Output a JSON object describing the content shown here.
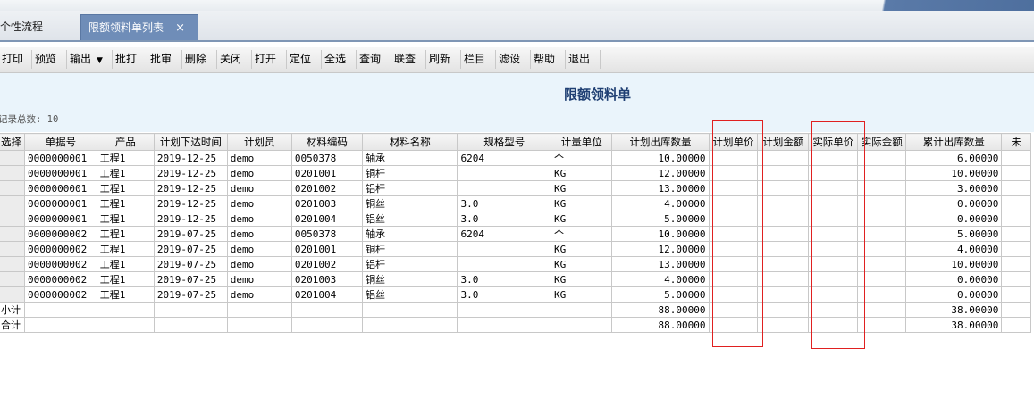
{
  "tabs": [
    {
      "label": "个性流程"
    },
    {
      "label": "限额领料单列表",
      "close": "×"
    }
  ],
  "toolbar": {
    "buttons": [
      "打印",
      "预览",
      "输出",
      "批打",
      "批审",
      "删除",
      "关闭",
      "打开",
      "定位",
      "全选",
      "查询",
      "联查",
      "刷新",
      "栏目",
      "滤设",
      "帮助",
      "退出"
    ],
    "dropdown_arrow": "▼"
  },
  "report": {
    "title": "限额领料单",
    "record_count_label": "记录总数:",
    "record_count": "10"
  },
  "table": {
    "headers": [
      "选择",
      "单据号",
      "产品",
      "计划下达时间",
      "计划员",
      "材料编码",
      "材料名称",
      "规格型号",
      "计量单位",
      "计划出库数量",
      "计划单价",
      "计划金额",
      "实际单价",
      "实际金额",
      "累计出库数量",
      "未"
    ],
    "rows": [
      [
        "",
        "0000000001",
        "工程1",
        "2019-12-25",
        "demo",
        "0050378",
        "轴承",
        "6204",
        "个",
        "10.00000",
        "",
        "",
        "",
        "",
        "6.00000",
        ""
      ],
      [
        "",
        "0000000001",
        "工程1",
        "2019-12-25",
        "demo",
        "0201001",
        "铜杆",
        "",
        "KG",
        "12.00000",
        "",
        "",
        "",
        "",
        "10.00000",
        ""
      ],
      [
        "",
        "0000000001",
        "工程1",
        "2019-12-25",
        "demo",
        "0201002",
        "铝杆",
        "",
        "KG",
        "13.00000",
        "",
        "",
        "",
        "",
        "3.00000",
        ""
      ],
      [
        "",
        "0000000001",
        "工程1",
        "2019-12-25",
        "demo",
        "0201003",
        "铜丝",
        "3.0",
        "KG",
        "4.00000",
        "",
        "",
        "",
        "",
        "0.00000",
        ""
      ],
      [
        "",
        "0000000001",
        "工程1",
        "2019-12-25",
        "demo",
        "0201004",
        "铝丝",
        "3.0",
        "KG",
        "5.00000",
        "",
        "",
        "",
        "",
        "0.00000",
        ""
      ],
      [
        "",
        "0000000002",
        "工程1",
        "2019-07-25",
        "demo",
        "0050378",
        "轴承",
        "6204",
        "个",
        "10.00000",
        "",
        "",
        "",
        "",
        "5.00000",
        ""
      ],
      [
        "",
        "0000000002",
        "工程1",
        "2019-07-25",
        "demo",
        "0201001",
        "铜杆",
        "",
        "KG",
        "12.00000",
        "",
        "",
        "",
        "",
        "4.00000",
        ""
      ],
      [
        "",
        "0000000002",
        "工程1",
        "2019-07-25",
        "demo",
        "0201002",
        "铝杆",
        "",
        "KG",
        "13.00000",
        "",
        "",
        "",
        "",
        "10.00000",
        ""
      ],
      [
        "",
        "0000000002",
        "工程1",
        "2019-07-25",
        "demo",
        "0201003",
        "铜丝",
        "3.0",
        "KG",
        "4.00000",
        "",
        "",
        "",
        "",
        "0.00000",
        ""
      ],
      [
        "",
        "0000000002",
        "工程1",
        "2019-07-25",
        "demo",
        "0201004",
        "铝丝",
        "3.0",
        "KG",
        "5.00000",
        "",
        "",
        "",
        "",
        "0.00000",
        ""
      ]
    ],
    "subtotal": {
      "label": "小计",
      "planned_qty": "88.00000",
      "cumulative_qty": "38.00000"
    },
    "total": {
      "label": "合计",
      "planned_qty": "88.00000",
      "cumulative_qty": "38.00000"
    }
  },
  "colors": {
    "highlight_box": "#e02020",
    "title": "#1f3f73",
    "active_tab": "#6f8db8"
  }
}
